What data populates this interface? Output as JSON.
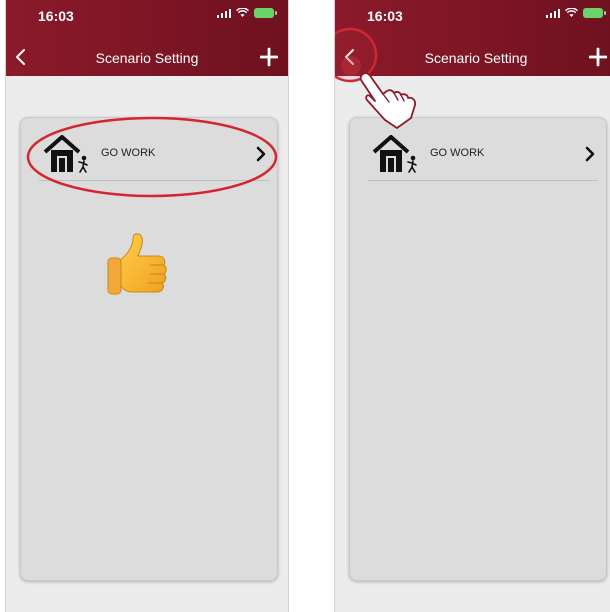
{
  "screens": [
    {
      "status": {
        "time": "16:03"
      },
      "nav": {
        "title": "Scenario Setting"
      },
      "scenario_items": [
        {
          "label": "GO WORK"
        }
      ]
    },
    {
      "status": {
        "time": "16:03"
      },
      "nav": {
        "title": "Scenario Setting"
      },
      "scenario_items": [
        {
          "label": "GO WORK"
        }
      ]
    }
  ],
  "colors": {
    "header": "#8b1a2a",
    "card": "#dcdcdc",
    "highlight": "#d22630",
    "battery": "#6ad46a"
  },
  "icons": {
    "back": "chevron-left-icon",
    "add": "plus-icon",
    "scenario": "house-person-icon",
    "row_arrow": "chevron-right-icon",
    "thumb": "thumbs-up-icon",
    "tap": "pointing-hand-icon"
  }
}
